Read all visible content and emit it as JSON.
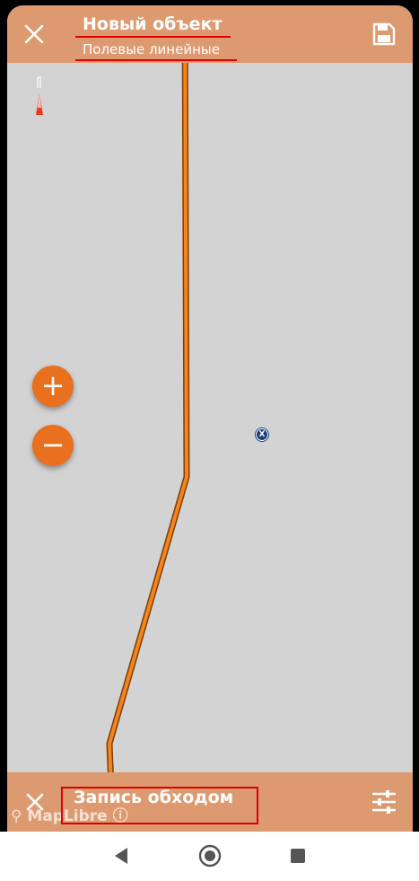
{
  "header": {
    "title": "Новый объект",
    "subtitle": "Полевые линейные",
    "close_icon": "close-icon",
    "save_icon": "save-icon"
  },
  "map": {
    "compass_icon": "compass-icon",
    "marker_label": "X",
    "zoom_in_label": "+",
    "zoom_out_label": "−",
    "attribution": "MapLibre",
    "line_color": "#f07c12"
  },
  "bottom_bar": {
    "close_icon": "close-icon",
    "mode_label": "Запись обходом",
    "settings_icon": "sliders-icon"
  },
  "nav": {
    "back_icon": "back-triangle-icon",
    "home_icon": "home-circle-icon",
    "recents_icon": "recents-square-icon"
  },
  "colors": {
    "accent": "#dd9a70",
    "map_bg": "#d3d3d3",
    "zoom_button": "#e8701e",
    "highlight": "#e00000"
  }
}
